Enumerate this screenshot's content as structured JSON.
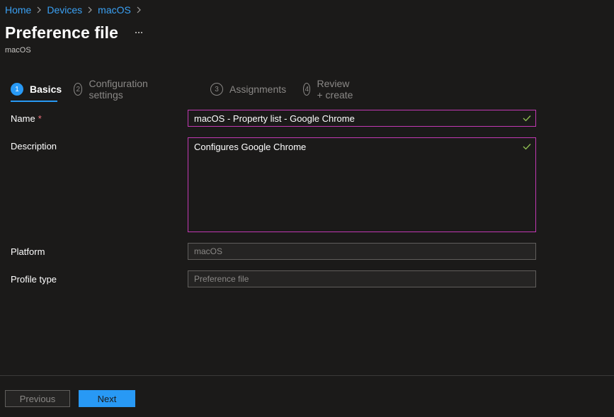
{
  "breadcrumb": {
    "items": [
      "Home",
      "Devices",
      "macOS"
    ]
  },
  "header": {
    "title": "Preference file",
    "subtitle": "macOS"
  },
  "steps": [
    {
      "number": "1",
      "label": "Basics",
      "active": true
    },
    {
      "number": "2",
      "label": "Configuration settings",
      "active": false
    },
    {
      "number": "3",
      "label": "Assignments",
      "active": false
    },
    {
      "number": "4",
      "label": "Review + create",
      "active": false
    }
  ],
  "form": {
    "name_label": "Name",
    "required_marker": "*",
    "name_value": "macOS - Property list - Google Chrome",
    "description_label": "Description",
    "description_value": "Configures Google Chrome",
    "platform_label": "Platform",
    "platform_value": "macOS",
    "profile_type_label": "Profile type",
    "profile_type_value": "Preference file"
  },
  "footer": {
    "previous_label": "Previous",
    "next_label": "Next"
  },
  "colors": {
    "background": "#1b1a19",
    "link": "#3aa0f3",
    "accent": "#2899f5",
    "field_border_focus": "#c239b3",
    "valid_check": "#92c353",
    "required": "#f1707b"
  }
}
